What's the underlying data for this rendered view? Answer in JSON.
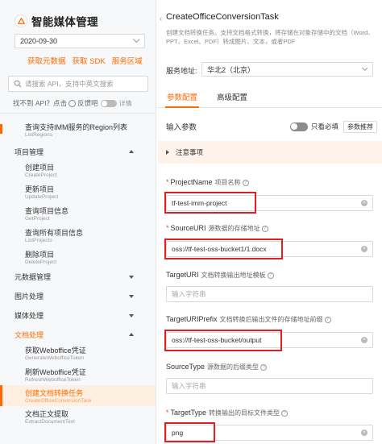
{
  "sidebar": {
    "brand_title": "智能媒体管理",
    "version": "2020-09-30",
    "links": [
      "获取元数据",
      "获取 SDK",
      "服务区域"
    ],
    "search_placeholder": "请搜索 API，支持中英文搜索",
    "feedback_prefix": "找不到 API？点击",
    "feedback_text": "反馈吧",
    "detail_label": "详情",
    "nav": [
      {
        "cn": "查询支持IMM服务的Region列表",
        "en": "ListRegions"
      },
      {
        "group": "项目管理"
      },
      {
        "cn": "创建项目",
        "en": "CreateProject"
      },
      {
        "cn": "更新项目",
        "en": "UpdateProject"
      },
      {
        "cn": "查询项目信息",
        "en": "GetProject"
      },
      {
        "cn": "查询所有项目信息",
        "en": "ListProjects"
      },
      {
        "cn": "删除项目",
        "en": "DeleteProject"
      },
      {
        "group": "元数据管理"
      },
      {
        "group": "图片处理"
      },
      {
        "group": "媒体处理"
      },
      {
        "group": "文档处理"
      },
      {
        "cn": "获取Weboffice凭证",
        "en": "GenerateWebofficeToken"
      },
      {
        "cn": "刷新Weboffice凭证",
        "en": "RefreshWebofficeToken"
      },
      {
        "cn": "创建文档转换任务",
        "en": "CreateOfficeConversionTask"
      },
      {
        "cn": "文档正文提取",
        "en": "ExtractDocumentText"
      }
    ]
  },
  "panel": {
    "api_title": "CreateOfficeConversionTask",
    "api_desc": "创建文档转换任务。支持文档格式转换，将存储在对象存储中的文档（Word、PPT、Excel、PDF）转成图片、文本，或者PDF",
    "region_label": "服务地址:",
    "region_value": "华北2（北京）",
    "tabs": [
      "参数配置",
      "高级配置"
    ],
    "params_title": "输入参数",
    "required_only_label": "只看必填",
    "recommend_label": "参数推荐",
    "notice": "注意事项",
    "fields": [
      {
        "name": "ProjectName",
        "desc": "项目名称",
        "required": true,
        "value": "tf-test-imm-project",
        "placeholder": ""
      },
      {
        "name": "SourceURI",
        "desc": "源数据的存储地址",
        "required": true,
        "value": "oss://tf-test-oss-bucket1/1.docx",
        "placeholder": ""
      },
      {
        "name": "TargetURI",
        "desc": "文档转换输出地址模板",
        "required": false,
        "value": "",
        "placeholder": "输入字符串"
      },
      {
        "name": "TargetURIPrefix",
        "desc": "文档转换后输出文件的存储地址前缀",
        "required": false,
        "value": "oss://tf-test-oss-bucket/output",
        "placeholder": ""
      },
      {
        "name": "SourceType",
        "desc": "源数据的后缀类型",
        "required": false,
        "value": "",
        "placeholder": "输入字符串"
      },
      {
        "name": "TargetType",
        "desc": "转换输出的目标文件类型",
        "required": true,
        "value": "png",
        "placeholder": ""
      }
    ]
  },
  "colors": {
    "accent": "#ff6a00",
    "highlight": "#e02020",
    "notice_bg": "#fdf3ea"
  }
}
